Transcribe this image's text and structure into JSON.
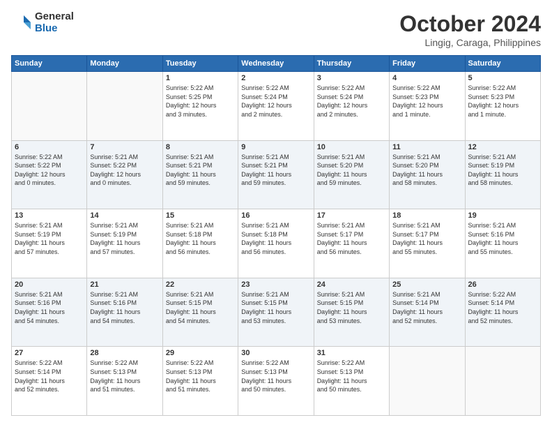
{
  "logo": {
    "general": "General",
    "blue": "Blue"
  },
  "header": {
    "month": "October 2024",
    "location": "Lingig, Caraga, Philippines"
  },
  "weekdays": [
    "Sunday",
    "Monday",
    "Tuesday",
    "Wednesday",
    "Thursday",
    "Friday",
    "Saturday"
  ],
  "weeks": [
    [
      {
        "day": "",
        "info": ""
      },
      {
        "day": "",
        "info": ""
      },
      {
        "day": "1",
        "info": "Sunrise: 5:22 AM\nSunset: 5:25 PM\nDaylight: 12 hours\nand 3 minutes."
      },
      {
        "day": "2",
        "info": "Sunrise: 5:22 AM\nSunset: 5:24 PM\nDaylight: 12 hours\nand 2 minutes."
      },
      {
        "day": "3",
        "info": "Sunrise: 5:22 AM\nSunset: 5:24 PM\nDaylight: 12 hours\nand 2 minutes."
      },
      {
        "day": "4",
        "info": "Sunrise: 5:22 AM\nSunset: 5:23 PM\nDaylight: 12 hours\nand 1 minute."
      },
      {
        "day": "5",
        "info": "Sunrise: 5:22 AM\nSunset: 5:23 PM\nDaylight: 12 hours\nand 1 minute."
      }
    ],
    [
      {
        "day": "6",
        "info": "Sunrise: 5:22 AM\nSunset: 5:22 PM\nDaylight: 12 hours\nand 0 minutes."
      },
      {
        "day": "7",
        "info": "Sunrise: 5:21 AM\nSunset: 5:22 PM\nDaylight: 12 hours\nand 0 minutes."
      },
      {
        "day": "8",
        "info": "Sunrise: 5:21 AM\nSunset: 5:21 PM\nDaylight: 11 hours\nand 59 minutes."
      },
      {
        "day": "9",
        "info": "Sunrise: 5:21 AM\nSunset: 5:21 PM\nDaylight: 11 hours\nand 59 minutes."
      },
      {
        "day": "10",
        "info": "Sunrise: 5:21 AM\nSunset: 5:20 PM\nDaylight: 11 hours\nand 59 minutes."
      },
      {
        "day": "11",
        "info": "Sunrise: 5:21 AM\nSunset: 5:20 PM\nDaylight: 11 hours\nand 58 minutes."
      },
      {
        "day": "12",
        "info": "Sunrise: 5:21 AM\nSunset: 5:19 PM\nDaylight: 11 hours\nand 58 minutes."
      }
    ],
    [
      {
        "day": "13",
        "info": "Sunrise: 5:21 AM\nSunset: 5:19 PM\nDaylight: 11 hours\nand 57 minutes."
      },
      {
        "day": "14",
        "info": "Sunrise: 5:21 AM\nSunset: 5:19 PM\nDaylight: 11 hours\nand 57 minutes."
      },
      {
        "day": "15",
        "info": "Sunrise: 5:21 AM\nSunset: 5:18 PM\nDaylight: 11 hours\nand 56 minutes."
      },
      {
        "day": "16",
        "info": "Sunrise: 5:21 AM\nSunset: 5:18 PM\nDaylight: 11 hours\nand 56 minutes."
      },
      {
        "day": "17",
        "info": "Sunrise: 5:21 AM\nSunset: 5:17 PM\nDaylight: 11 hours\nand 56 minutes."
      },
      {
        "day": "18",
        "info": "Sunrise: 5:21 AM\nSunset: 5:17 PM\nDaylight: 11 hours\nand 55 minutes."
      },
      {
        "day": "19",
        "info": "Sunrise: 5:21 AM\nSunset: 5:16 PM\nDaylight: 11 hours\nand 55 minutes."
      }
    ],
    [
      {
        "day": "20",
        "info": "Sunrise: 5:21 AM\nSunset: 5:16 PM\nDaylight: 11 hours\nand 54 minutes."
      },
      {
        "day": "21",
        "info": "Sunrise: 5:21 AM\nSunset: 5:16 PM\nDaylight: 11 hours\nand 54 minutes."
      },
      {
        "day": "22",
        "info": "Sunrise: 5:21 AM\nSunset: 5:15 PM\nDaylight: 11 hours\nand 54 minutes."
      },
      {
        "day": "23",
        "info": "Sunrise: 5:21 AM\nSunset: 5:15 PM\nDaylight: 11 hours\nand 53 minutes."
      },
      {
        "day": "24",
        "info": "Sunrise: 5:21 AM\nSunset: 5:15 PM\nDaylight: 11 hours\nand 53 minutes."
      },
      {
        "day": "25",
        "info": "Sunrise: 5:21 AM\nSunset: 5:14 PM\nDaylight: 11 hours\nand 52 minutes."
      },
      {
        "day": "26",
        "info": "Sunrise: 5:22 AM\nSunset: 5:14 PM\nDaylight: 11 hours\nand 52 minutes."
      }
    ],
    [
      {
        "day": "27",
        "info": "Sunrise: 5:22 AM\nSunset: 5:14 PM\nDaylight: 11 hours\nand 52 minutes."
      },
      {
        "day": "28",
        "info": "Sunrise: 5:22 AM\nSunset: 5:13 PM\nDaylight: 11 hours\nand 51 minutes."
      },
      {
        "day": "29",
        "info": "Sunrise: 5:22 AM\nSunset: 5:13 PM\nDaylight: 11 hours\nand 51 minutes."
      },
      {
        "day": "30",
        "info": "Sunrise: 5:22 AM\nSunset: 5:13 PM\nDaylight: 11 hours\nand 50 minutes."
      },
      {
        "day": "31",
        "info": "Sunrise: 5:22 AM\nSunset: 5:13 PM\nDaylight: 11 hours\nand 50 minutes."
      },
      {
        "day": "",
        "info": ""
      },
      {
        "day": "",
        "info": ""
      }
    ]
  ]
}
